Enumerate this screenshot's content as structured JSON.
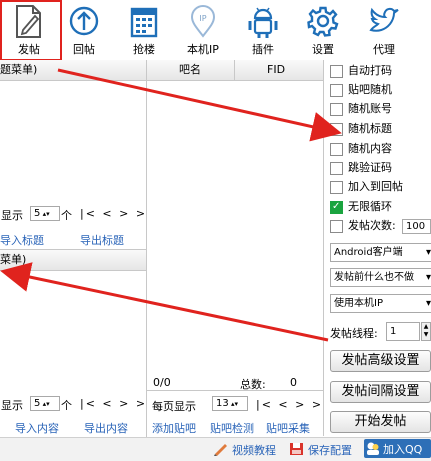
{
  "toolbar": {
    "items": [
      {
        "label": "发帖",
        "icon": "edit-document-icon"
      },
      {
        "label": "回帖",
        "icon": "upload-circle-icon"
      },
      {
        "label": "抢楼",
        "icon": "calendar-icon"
      },
      {
        "label": "本机IP",
        "icon": "ip-location-icon"
      },
      {
        "label": "插件",
        "icon": "android-icon"
      },
      {
        "label": "设置",
        "icon": "gear-icon"
      },
      {
        "label": "代理",
        "icon": "bird-icon"
      }
    ]
  },
  "left_top": {
    "header": "题菜单)",
    "show_label": "显示",
    "per_page_value": "5",
    "per_page_unit": "个",
    "nav": "|< < > >|",
    "import_label": "导入标题",
    "export_label": "导出标题"
  },
  "left_bottom": {
    "header": "菜单)",
    "show_label": "显示",
    "per_page_value": "5",
    "per_page_unit": "个",
    "nav": "|< < > >|",
    "import_label": "导入内容",
    "export_label": "导出内容"
  },
  "bar_table": {
    "col_name": "吧名",
    "col_fid": "FID",
    "count": "0/0",
    "total_label": "总数:",
    "total_value": "0",
    "per_page_label": "每页显示",
    "per_page_value": "13",
    "nav": "|< < > >|",
    "add_link": "添加贴吧",
    "check_link": "贴吧检测",
    "collect_link": "贴吧采集"
  },
  "options": {
    "checkboxes": [
      {
        "label": "自动打码",
        "checked": false
      },
      {
        "label": "贴吧随机",
        "checked": false
      },
      {
        "label": "随机账号",
        "checked": false
      },
      {
        "label": "随机标题",
        "checked": false
      },
      {
        "label": "随机内容",
        "checked": false
      },
      {
        "label": "跳验证码",
        "checked": false
      },
      {
        "label": "加入到回帖",
        "checked": false
      },
      {
        "label": "无限循环",
        "checked": true
      }
    ],
    "post_count_label": "发帖次数:",
    "post_count_value": "100",
    "client_select": "Android客户端",
    "before_post_select": "发帖前什么也不做",
    "ip_select": "使用本机IP",
    "threads_label": "发帖线程:",
    "threads_value": "1",
    "advanced_button": "发帖高级设置",
    "interval_button": "发帖间隔设置",
    "start_button": "开始发帖"
  },
  "footer": {
    "video_tutorial": "视频教程",
    "save_config": "保存配置",
    "join_qq": "加入QQ"
  },
  "colors": {
    "annotation_red": "#e0231e",
    "link_blue": "#2a64b8",
    "check_green": "#1aa43f",
    "icon_blue": "#1f6fb8"
  }
}
